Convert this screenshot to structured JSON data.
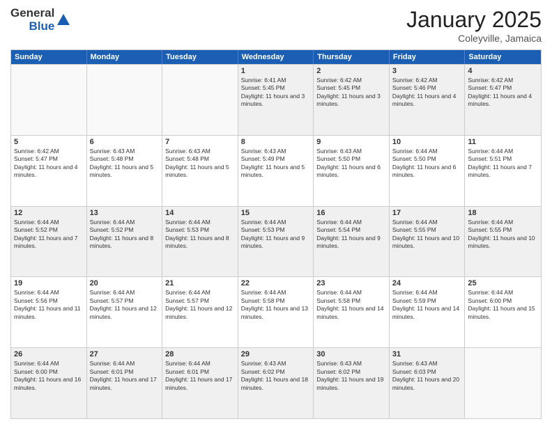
{
  "header": {
    "logo_general": "General",
    "logo_blue": "Blue",
    "month_title": "January 2025",
    "location": "Coleyville, Jamaica"
  },
  "days_of_week": [
    "Sunday",
    "Monday",
    "Tuesday",
    "Wednesday",
    "Thursday",
    "Friday",
    "Saturday"
  ],
  "weeks": [
    [
      {
        "day": "",
        "empty": true
      },
      {
        "day": "",
        "empty": true
      },
      {
        "day": "",
        "empty": true
      },
      {
        "day": "1",
        "sunrise": "6:41 AM",
        "sunset": "5:45 PM",
        "daylight": "11 hours and 3 minutes."
      },
      {
        "day": "2",
        "sunrise": "6:42 AM",
        "sunset": "5:45 PM",
        "daylight": "11 hours and 3 minutes."
      },
      {
        "day": "3",
        "sunrise": "6:42 AM",
        "sunset": "5:46 PM",
        "daylight": "11 hours and 4 minutes."
      },
      {
        "day": "4",
        "sunrise": "6:42 AM",
        "sunset": "5:47 PM",
        "daylight": "11 hours and 4 minutes."
      }
    ],
    [
      {
        "day": "5",
        "sunrise": "6:42 AM",
        "sunset": "5:47 PM",
        "daylight": "11 hours and 4 minutes."
      },
      {
        "day": "6",
        "sunrise": "6:43 AM",
        "sunset": "5:48 PM",
        "daylight": "11 hours and 5 minutes."
      },
      {
        "day": "7",
        "sunrise": "6:43 AM",
        "sunset": "5:48 PM",
        "daylight": "11 hours and 5 minutes."
      },
      {
        "day": "8",
        "sunrise": "6:43 AM",
        "sunset": "5:49 PM",
        "daylight": "11 hours and 5 minutes."
      },
      {
        "day": "9",
        "sunrise": "6:43 AM",
        "sunset": "5:50 PM",
        "daylight": "11 hours and 6 minutes."
      },
      {
        "day": "10",
        "sunrise": "6:44 AM",
        "sunset": "5:50 PM",
        "daylight": "11 hours and 6 minutes."
      },
      {
        "day": "11",
        "sunrise": "6:44 AM",
        "sunset": "5:51 PM",
        "daylight": "11 hours and 7 minutes."
      }
    ],
    [
      {
        "day": "12",
        "sunrise": "6:44 AM",
        "sunset": "5:52 PM",
        "daylight": "11 hours and 7 minutes."
      },
      {
        "day": "13",
        "sunrise": "6:44 AM",
        "sunset": "5:52 PM",
        "daylight": "11 hours and 8 minutes."
      },
      {
        "day": "14",
        "sunrise": "6:44 AM",
        "sunset": "5:53 PM",
        "daylight": "11 hours and 8 minutes."
      },
      {
        "day": "15",
        "sunrise": "6:44 AM",
        "sunset": "5:53 PM",
        "daylight": "11 hours and 9 minutes."
      },
      {
        "day": "16",
        "sunrise": "6:44 AM",
        "sunset": "5:54 PM",
        "daylight": "11 hours and 9 minutes."
      },
      {
        "day": "17",
        "sunrise": "6:44 AM",
        "sunset": "5:55 PM",
        "daylight": "11 hours and 10 minutes."
      },
      {
        "day": "18",
        "sunrise": "6:44 AM",
        "sunset": "5:55 PM",
        "daylight": "11 hours and 10 minutes."
      }
    ],
    [
      {
        "day": "19",
        "sunrise": "6:44 AM",
        "sunset": "5:56 PM",
        "daylight": "11 hours and 11 minutes."
      },
      {
        "day": "20",
        "sunrise": "6:44 AM",
        "sunset": "5:57 PM",
        "daylight": "11 hours and 12 minutes."
      },
      {
        "day": "21",
        "sunrise": "6:44 AM",
        "sunset": "5:57 PM",
        "daylight": "11 hours and 12 minutes."
      },
      {
        "day": "22",
        "sunrise": "6:44 AM",
        "sunset": "5:58 PM",
        "daylight": "11 hours and 13 minutes."
      },
      {
        "day": "23",
        "sunrise": "6:44 AM",
        "sunset": "5:58 PM",
        "daylight": "11 hours and 14 minutes."
      },
      {
        "day": "24",
        "sunrise": "6:44 AM",
        "sunset": "5:59 PM",
        "daylight": "11 hours and 14 minutes."
      },
      {
        "day": "25",
        "sunrise": "6:44 AM",
        "sunset": "6:00 PM",
        "daylight": "11 hours and 15 minutes."
      }
    ],
    [
      {
        "day": "26",
        "sunrise": "6:44 AM",
        "sunset": "6:00 PM",
        "daylight": "11 hours and 16 minutes."
      },
      {
        "day": "27",
        "sunrise": "6:44 AM",
        "sunset": "6:01 PM",
        "daylight": "11 hours and 17 minutes."
      },
      {
        "day": "28",
        "sunrise": "6:44 AM",
        "sunset": "6:01 PM",
        "daylight": "11 hours and 17 minutes."
      },
      {
        "day": "29",
        "sunrise": "6:43 AM",
        "sunset": "6:02 PM",
        "daylight": "11 hours and 18 minutes."
      },
      {
        "day": "30",
        "sunrise": "6:43 AM",
        "sunset": "6:02 PM",
        "daylight": "11 hours and 19 minutes."
      },
      {
        "day": "31",
        "sunrise": "6:43 AM",
        "sunset": "6:03 PM",
        "daylight": "11 hours and 20 minutes."
      },
      {
        "day": "",
        "empty": true
      }
    ]
  ],
  "labels": {
    "sunrise": "Sunrise:",
    "sunset": "Sunset:",
    "daylight": "Daylight:"
  }
}
